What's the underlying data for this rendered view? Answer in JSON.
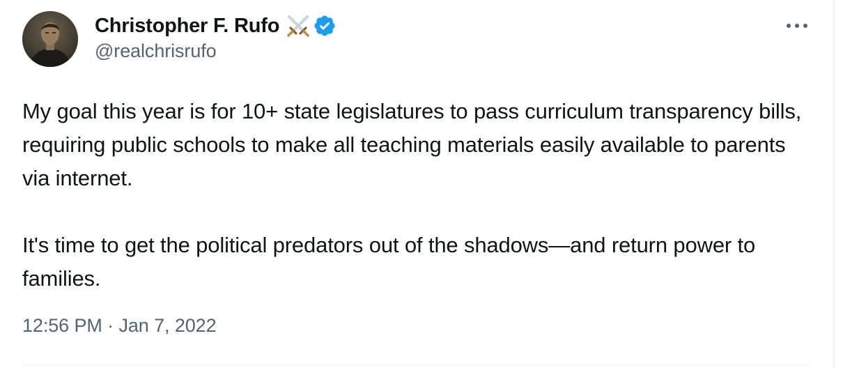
{
  "author": {
    "display_name": "Christopher F. Rufo",
    "handle": "@realchrisrufo",
    "name_emoji_icon": "crossed-swords-icon",
    "verified_icon": "verified-badge-icon",
    "verified_color": "#1d9bf0"
  },
  "tweet": {
    "paragraphs": [
      "My goal this year is for 10+ state legislatures to pass curriculum transparency bills, requiring public schools to make all teaching materials easily available to parents via internet.",
      "It's time to get the political predators out of the shadows—and return power to families."
    ],
    "timestamp": "12:56 PM · Jan 7, 2022"
  },
  "menu": {
    "more_icon": "more-horizontal-icon"
  },
  "colors": {
    "text_primary": "#0f1419",
    "text_secondary": "#536471",
    "border": "#eff3f4"
  }
}
